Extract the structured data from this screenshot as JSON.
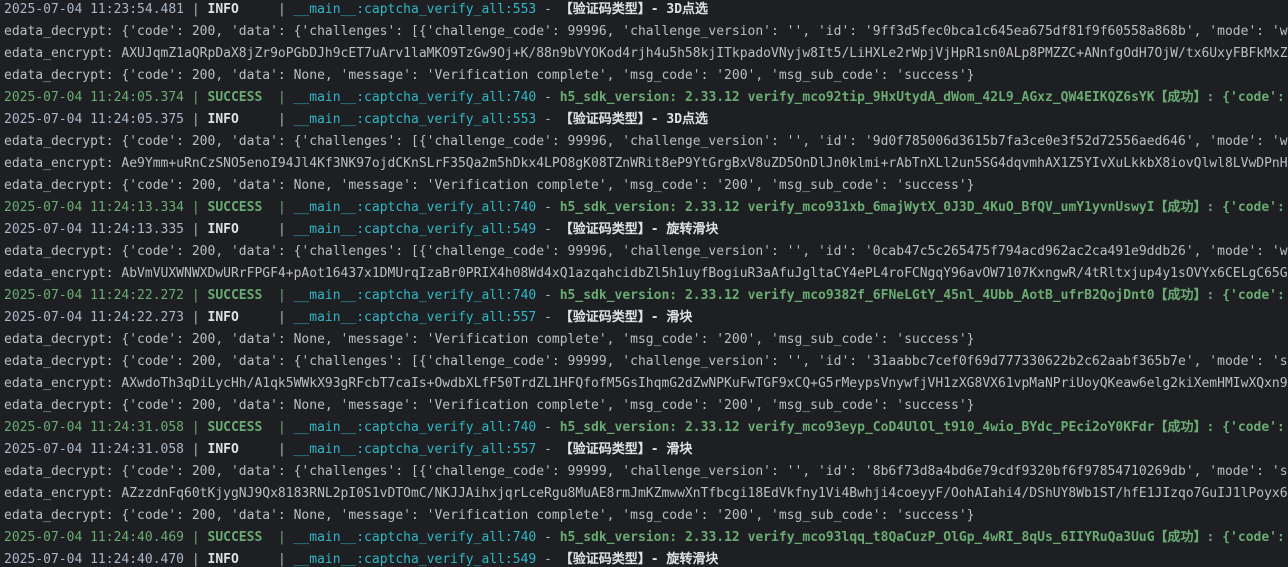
{
  "colors": {
    "background": "#1e1f22",
    "plain_text": "#bcbec4",
    "success": "#6aab73",
    "module": "#2fb8c7",
    "info_level": "#dfe1e5"
  },
  "lines": [
    {
      "kind": "log",
      "level_type": "info",
      "timestamp": "2025-07-04 11:23:54.481",
      "sep1": " | ",
      "level": "INFO    ",
      "sep2": " | ",
      "module": "__main__:captcha_verify_all:553",
      "dash": " - ",
      "message": "【验证码类型】- 3D点选"
    },
    {
      "kind": "plain",
      "text": "edata_decrypt: {'code': 200, 'data': {'challenges': [{'challenge_code': 99996, 'challenge_version': '', 'id': '9ff3d5fec0bca1c645ea675df81f9f60558a868b', 'mode': 'wh"
    },
    {
      "kind": "plain",
      "text": "edata_encrypt: AXUJqmZ1aQRpDaX8jZr9oPGbDJh9cET7uArv1laMKO9TzGw9Oj+K/88n9bVYOKod4rjh4u5h58kjITkpadoVNyjw8It5/LiHXLe2rWpjVjHpR1sn0ALp8PMZZC+ANnfgOdH7OjW/tx6UxyFBFkMxZB"
    },
    {
      "kind": "plain",
      "text": "edata_decrypt: {'code': 200, 'data': None, 'message': 'Verification complete', 'msg_code': '200', 'msg_sub_code': 'success'}"
    },
    {
      "kind": "log",
      "level_type": "success",
      "timestamp": "2025-07-04 11:24:05.374",
      "sep1": " | ",
      "level": "SUCCESS ",
      "sep2": " | ",
      "module": "__main__:captcha_verify_all:740",
      "dash": " - ",
      "message": "h5_sdk_version: 2.33.12 verify_mco92tip_9HxUtydA_dWom_42L9_AGxz_QW4EIKQZ6sYK【成功】: {'code':"
    },
    {
      "kind": "log",
      "level_type": "info",
      "timestamp": "2025-07-04 11:24:05.375",
      "sep1": " | ",
      "level": "INFO    ",
      "sep2": " | ",
      "module": "__main__:captcha_verify_all:553",
      "dash": " - ",
      "message": "【验证码类型】- 3D点选"
    },
    {
      "kind": "plain",
      "text": "edata_decrypt: {'code': 200, 'data': {'challenges': [{'challenge_code': 99996, 'challenge_version': '', 'id': '9d0f785006d3615b7fa3ce0e3f52d72556aed646', 'mode': 'wh"
    },
    {
      "kind": "plain",
      "text": "edata_encrypt: Ae9Ymm+uRnCzSNO5enoI94Jl4Kf3NK97ojdCKnSLrF35Qa2m5hDkx4LPO8gK08TZnWRit8eP9YtGrgBxV8uZD5OnDlJn0klmi+rAbTnXLl2un5SG4dqvmhAX1Z5YIvXuLkkbX8iovQlwl8LVwDPnH7"
    },
    {
      "kind": "plain",
      "text": "edata_decrypt: {'code': 200, 'data': None, 'message': 'Verification complete', 'msg_code': '200', 'msg_sub_code': 'success'}"
    },
    {
      "kind": "log",
      "level_type": "success",
      "timestamp": "2025-07-04 11:24:13.334",
      "sep1": " | ",
      "level": "SUCCESS ",
      "sep2": " | ",
      "module": "__main__:captcha_verify_all:740",
      "dash": " - ",
      "message": "h5_sdk_version: 2.33.12 verify_mco931xb_6majWytX_0J3D_4KuO_BfQV_umY1yvnUswyI【成功】: {'code':"
    },
    {
      "kind": "log",
      "level_type": "info",
      "timestamp": "2025-07-04 11:24:13.335",
      "sep1": " | ",
      "level": "INFO    ",
      "sep2": " | ",
      "module": "__main__:captcha_verify_all:549",
      "dash": " - ",
      "message": "【验证码类型】- 旋转滑块"
    },
    {
      "kind": "plain",
      "text": "edata_decrypt: {'code': 200, 'data': {'challenges': [{'challenge_code': 99996, 'challenge_version': '', 'id': '0cab47c5c265475f794acd962ac2ca491e9ddb26', 'mode': 'wh"
    },
    {
      "kind": "plain",
      "text": "edata_encrypt: AbVmVUXWNWXDwURrFPGF4+pAot16437x1DMUrqIzaBr0PRIX4h08Wd4xQ1azqahcidbZl5h1uyfBogiuR3aAfuJgltaCY4ePL4roFCNgqY96avOW7107KxngwR/4tRltxjup4y1sOVYx6CELgC65Gu"
    },
    {
      "kind": "log",
      "level_type": "success",
      "timestamp": "2025-07-04 11:24:22.272",
      "sep1": " | ",
      "level": "SUCCESS ",
      "sep2": " | ",
      "module": "__main__:captcha_verify_all:740",
      "dash": " - ",
      "message": "h5_sdk_version: 2.33.12 verify_mco9382f_6FNeLGtY_45nl_4Ubb_AotB_ufrB2QojDnt0【成功】: {'code':"
    },
    {
      "kind": "log",
      "level_type": "info",
      "timestamp": "2025-07-04 11:24:22.273",
      "sep1": " | ",
      "level": "INFO    ",
      "sep2": " | ",
      "module": "__main__:captcha_verify_all:557",
      "dash": " - ",
      "message": "【验证码类型】- 滑块"
    },
    {
      "kind": "plain",
      "text": "edata_decrypt: {'code': 200, 'data': None, 'message': 'Verification complete', 'msg_code': '200', 'msg_sub_code': 'success'}"
    },
    {
      "kind": "plain",
      "text": "edata_decrypt: {'code': 200, 'data': {'challenges': [{'challenge_code': 99999, 'challenge_version': '', 'id': '31aabbc7cef0f69d777330622b2c62aabf365b7e', 'mode': 'sl"
    },
    {
      "kind": "plain",
      "text": "edata_encrypt: AXwdoTh3qDiLycHh/A1qk5WWkX93gRFcbT7caIs+OwdbXLfF50TrdZL1HFQfofM5GsIhqmG2dZwNPKuFwTGF9xCQ+G5rMeypsVnywfjVH1zXG8VX61vpMaNPriUoyQKeaw6elg2kiXemHMIwXQxn9P"
    },
    {
      "kind": "plain",
      "text": "edata_decrypt: {'code': 200, 'data': None, 'message': 'Verification complete', 'msg_code': '200', 'msg_sub_code': 'success'}"
    },
    {
      "kind": "log",
      "level_type": "success",
      "timestamp": "2025-07-04 11:24:31.058",
      "sep1": " | ",
      "level": "SUCCESS ",
      "sep2": " | ",
      "module": "__main__:captcha_verify_all:740",
      "dash": " - ",
      "message": "h5_sdk_version: 2.33.12 verify_mco93eyp_CoD4UlOl_t910_4wio_BYdc_PEci2oY0KFdr【成功】: {'code':"
    },
    {
      "kind": "log",
      "level_type": "info",
      "timestamp": "2025-07-04 11:24:31.058",
      "sep1": " | ",
      "level": "INFO    ",
      "sep2": " | ",
      "module": "__main__:captcha_verify_all:557",
      "dash": " - ",
      "message": "【验证码类型】- 滑块"
    },
    {
      "kind": "plain",
      "text": "edata_decrypt: {'code': 200, 'data': {'challenges': [{'challenge_code': 99999, 'challenge_version': '', 'id': '8b6f73d8a4bd6e79cdf9320bf6f97854710269db', 'mode': 'sl"
    },
    {
      "kind": "plain",
      "text": "edata_encrypt: AZzzdnFq60tKjygNJ9Qx8183RNL2pI0S1vDTOmC/NKJJAihxjqrLceRgu8MuAE8rmJmKZmwwXnTfbcgi18EdVkfny1Vi4Bwhji4coeyyF/OohAIahi4/DShUY8Wb1ST/hfE1JIzqo7GuIJ1lPoyx6L"
    },
    {
      "kind": "plain",
      "text": "edata_decrypt: {'code': 200, 'data': None, 'message': 'Verification complete', 'msg_code': '200', 'msg_sub_code': 'success'}"
    },
    {
      "kind": "log",
      "level_type": "success",
      "timestamp": "2025-07-04 11:24:40.469",
      "sep1": " | ",
      "level": "SUCCESS ",
      "sep2": " | ",
      "module": "__main__:captcha_verify_all:740",
      "dash": " - ",
      "message": "h5_sdk_version: 2.33.12 verify_mco93lqq_t8QaCuzP_OlGp_4wRI_8qUs_6IIYRuQa3UuG【成功】: {'code':"
    },
    {
      "kind": "log",
      "level_type": "info",
      "timestamp": "2025-07-04 11:24:40.470",
      "sep1": " | ",
      "level": "INFO    ",
      "sep2": " | ",
      "module": "__main__:captcha_verify_all:549",
      "dash": " - ",
      "message": "【验证码类型】- 旋转滑块"
    }
  ]
}
